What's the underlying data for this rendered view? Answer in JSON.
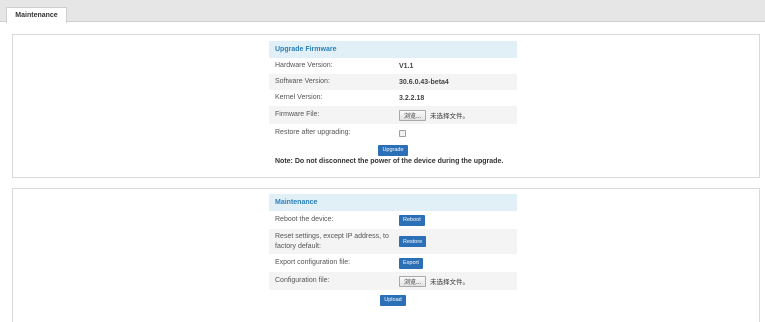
{
  "tabs": [
    {
      "label": "Maintenance",
      "active": true
    }
  ],
  "upgrade": {
    "title": "Upgrade Firmware",
    "hardware_label": "Hardware Version:",
    "hardware_value": "V1.1",
    "software_label": "Software Version:",
    "software_value": "30.6.0.43-beta4",
    "kernel_label": "Kernel Version:",
    "kernel_value": "3.2.2.18",
    "firmware_label": "Firmware File:",
    "browse_label": "浏览...",
    "no_file_text": "未选择文件。",
    "restore_label": "Restore after upgrading:",
    "restore_checked": false,
    "upgrade_button": "Upgrade",
    "note": "Note: Do not disconnect the power of the device during the upgrade."
  },
  "maintenance": {
    "title": "Maintenance",
    "reboot_label": "Reboot the device:",
    "reboot_button": "Reboot",
    "reset_label": "Reset settings, except IP address, to factory default:",
    "restore_button": "Restore",
    "export_label": "Export configuration file:",
    "export_button": "Export",
    "config_label": "Configuration file:",
    "browse_label": "浏览...",
    "no_file_text": "未选择文件。",
    "upload_button": "Upload"
  },
  "colors": {
    "accent": "#2b6fb6",
    "header_bg": "#e1f0f7",
    "header_text": "#2a7fb8"
  }
}
